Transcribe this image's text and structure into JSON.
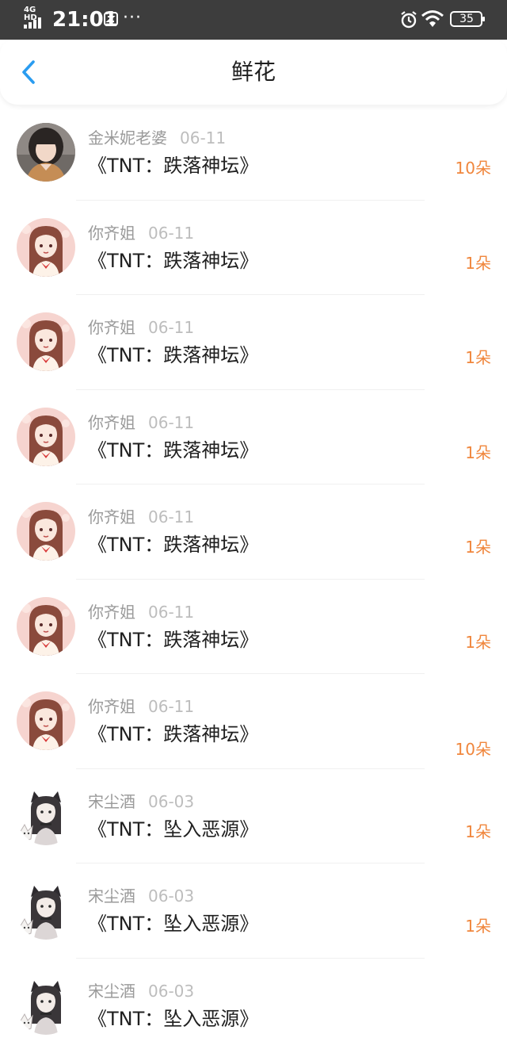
{
  "status_bar": {
    "network": "4G HD",
    "time": "21:01",
    "more_dots": "···",
    "battery": "35"
  },
  "header": {
    "title": "鲜花",
    "back_icon": "chevron-left-icon",
    "accent_color": "#2a9cf0"
  },
  "count_color": "#f0863c",
  "items": [
    {
      "name": "金米妮老婆",
      "date": "06-11",
      "work": "《TNT：跌落神坛》",
      "count": "10朵",
      "avatar": "photo-avatar"
    },
    {
      "name": "你齐姐",
      "date": "06-11",
      "work": "《TNT：跌落神坛》",
      "count": "1朵",
      "avatar": "anime-girl-avatar"
    },
    {
      "name": "你齐姐",
      "date": "06-11",
      "work": "《TNT：跌落神坛》",
      "count": "1朵",
      "avatar": "anime-girl-avatar"
    },
    {
      "name": "你齐姐",
      "date": "06-11",
      "work": "《TNT：跌落神坛》",
      "count": "1朵",
      "avatar": "anime-girl-avatar"
    },
    {
      "name": "你齐姐",
      "date": "06-11",
      "work": "《TNT：跌落神坛》",
      "count": "1朵",
      "avatar": "anime-girl-avatar"
    },
    {
      "name": "你齐姐",
      "date": "06-11",
      "work": "《TNT：跌落神坛》",
      "count": "1朵",
      "avatar": "anime-girl-avatar"
    },
    {
      "name": "你齐姐",
      "date": "06-11",
      "work": "《TNT：跌落神坛》",
      "count": "10朵",
      "avatar": "anime-girl-avatar"
    },
    {
      "name": "宋尘酒",
      "date": "06-03",
      "work": "《TNT：坠入恶源》",
      "count": "1朵",
      "avatar": "cat-ear-girl-avatar"
    },
    {
      "name": "宋尘酒",
      "date": "06-03",
      "work": "《TNT：坠入恶源》",
      "count": "1朵",
      "avatar": "cat-ear-girl-avatar"
    },
    {
      "name": "宋尘酒",
      "date": "06-03",
      "work": "《TNT：坠入恶源》",
      "count": "",
      "avatar": "cat-ear-girl-avatar"
    }
  ]
}
